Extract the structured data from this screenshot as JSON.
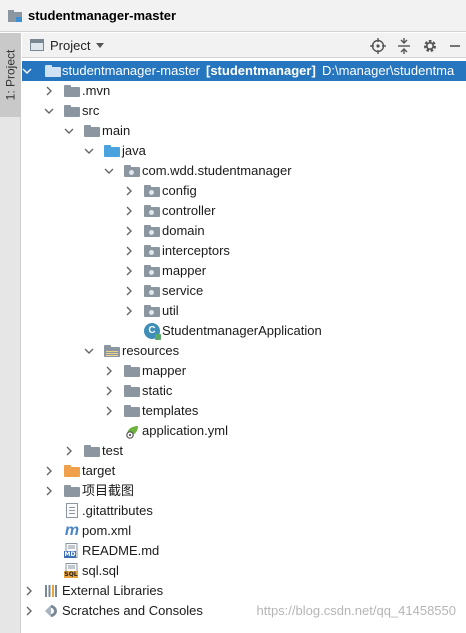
{
  "window": {
    "title": "studentmanager-master"
  },
  "side_tab": {
    "label": "1: Project"
  },
  "toolbar": {
    "view_label": "Project"
  },
  "tree": {
    "root": {
      "name": "studentmanager-master",
      "module": "[studentmanager]",
      "path": "D:\\manager\\studentma"
    },
    "items": [
      {
        "label": ".mvn"
      },
      {
        "label": "src"
      },
      {
        "label": "main"
      },
      {
        "label": "java"
      },
      {
        "label": "com.wdd.studentmanager"
      },
      {
        "label": "config"
      },
      {
        "label": "controller"
      },
      {
        "label": "domain"
      },
      {
        "label": "interceptors"
      },
      {
        "label": "mapper"
      },
      {
        "label": "service"
      },
      {
        "label": "util"
      },
      {
        "label": "StudentmanagerApplication"
      },
      {
        "label": "resources"
      },
      {
        "label": "mapper"
      },
      {
        "label": "static"
      },
      {
        "label": "templates"
      },
      {
        "label": "application.yml"
      },
      {
        "label": "test"
      },
      {
        "label": "target"
      },
      {
        "label": "项目截图"
      },
      {
        "label": ".gitattributes"
      },
      {
        "label": "pom.xml"
      },
      {
        "label": "README.md"
      },
      {
        "label": "sql.sql"
      },
      {
        "label": "External Libraries"
      },
      {
        "label": "Scratches and Consoles"
      }
    ]
  },
  "icons": {
    "java_class_letter": "C",
    "maven_letter": "m",
    "markdown_tag": "MD",
    "sql_tag": "SQL"
  },
  "watermark": "https://blog.csdn.net/qq_41458550",
  "colors": {
    "selection": "#2675bf",
    "source_folder": "#4aa3df",
    "excluded_folder": "#f0a04b"
  }
}
